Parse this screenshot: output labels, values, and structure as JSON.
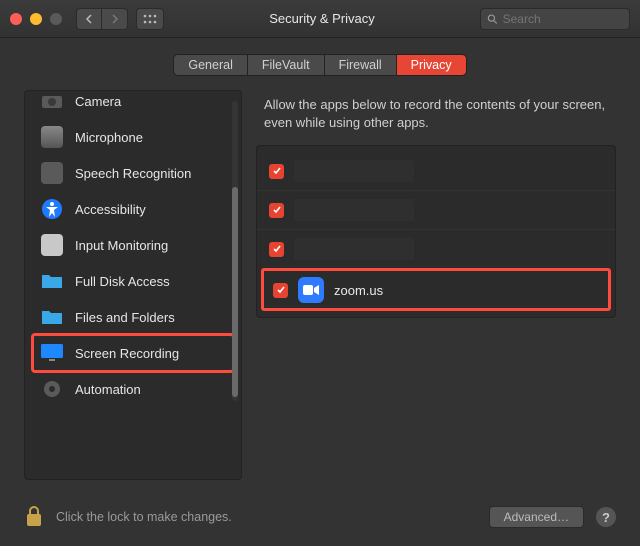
{
  "window": {
    "title": "Security & Privacy",
    "searchPlaceholder": "Search"
  },
  "tabs": [
    {
      "label": "General",
      "active": false
    },
    {
      "label": "FileVault",
      "active": false
    },
    {
      "label": "Firewall",
      "active": false
    },
    {
      "label": "Privacy",
      "active": true
    }
  ],
  "sidebar": {
    "items": [
      {
        "label": "Camera",
        "icon": "camera-icon",
        "selected": false
      },
      {
        "label": "Microphone",
        "icon": "microphone-icon",
        "selected": false
      },
      {
        "label": "Speech Recognition",
        "icon": "speech-icon",
        "selected": false
      },
      {
        "label": "Accessibility",
        "icon": "accessibility-icon",
        "selected": false
      },
      {
        "label": "Input Monitoring",
        "icon": "keyboard-icon",
        "selected": false
      },
      {
        "label": "Full Disk Access",
        "icon": "disk-folder-icon",
        "selected": false
      },
      {
        "label": "Files and Folders",
        "icon": "folder-icon",
        "selected": false
      },
      {
        "label": "Screen Recording",
        "icon": "display-icon",
        "selected": true
      },
      {
        "label": "Automation",
        "icon": "gear-icon",
        "selected": false
      }
    ]
  },
  "panel": {
    "description": "Allow the apps below to record the contents of your screen, even while using other apps.",
    "apps": [
      {
        "name": "",
        "redacted": true,
        "checked": true,
        "iconColor": "#2f2f2f",
        "highlight": false
      },
      {
        "name": "",
        "redacted": true,
        "checked": true,
        "iconColor": "#2f2f2f",
        "highlight": false
      },
      {
        "name": "",
        "redacted": true,
        "checked": true,
        "iconColor": "#2f2f2f",
        "highlight": false
      },
      {
        "name": "zoom.us",
        "redacted": false,
        "checked": true,
        "iconColor": "#2f7bff",
        "highlight": true
      }
    ]
  },
  "footer": {
    "lockText": "Click the lock to make changes.",
    "advanced": "Advanced…"
  }
}
